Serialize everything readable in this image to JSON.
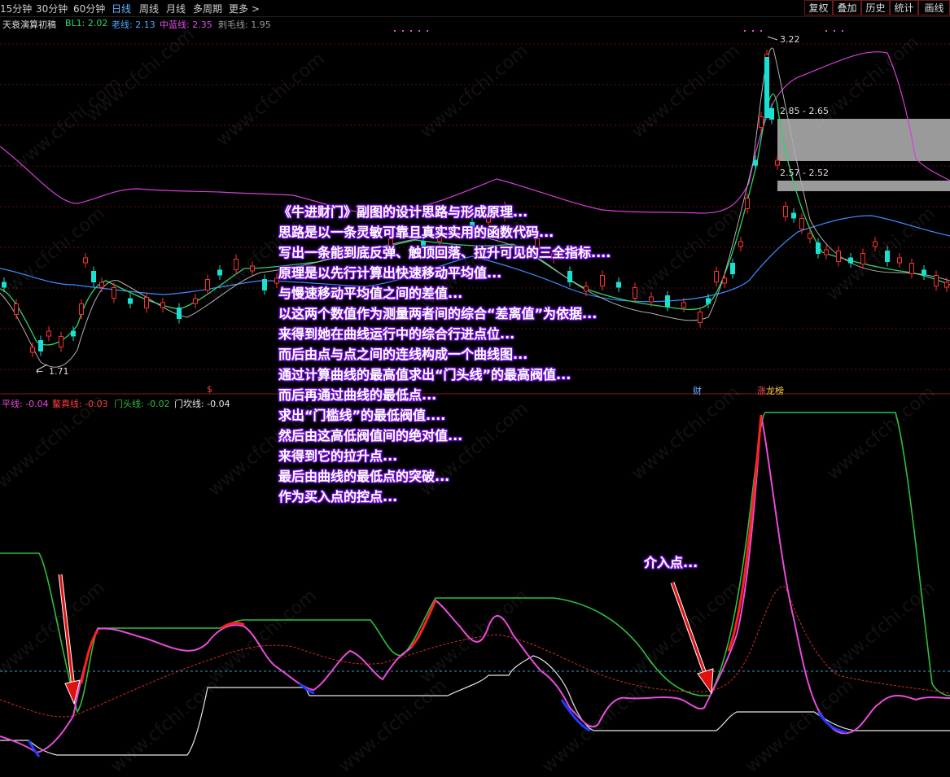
{
  "toolbar": {
    "periods": [
      "15分钟",
      "30分钟",
      "60分钟",
      "日线",
      "周线",
      "月线",
      "多周期",
      "更多 >"
    ],
    "active_period": "日线",
    "right_buttons": [
      "复权",
      "叠加",
      "历史",
      "统计",
      "画线"
    ]
  },
  "main_panel": {
    "title": "天衰演算初稿",
    "indicators": [
      {
        "label": "BL1: 2.02",
        "color": "#2fd46a"
      },
      {
        "label": "老线: 2.13",
        "color": "#4da6ff"
      },
      {
        "label": "中蓝线: 2.35",
        "color": "#e24be8"
      },
      {
        "label": "刺毛线: 1.95",
        "color": "#9a9a9a"
      }
    ],
    "price_labels": {
      "high": "3.22",
      "low": "1.71",
      "zone_upper": "2.85 - 2.65",
      "zone_lower": "2.57 - 2.52"
    },
    "event_markers": {
      "s": "$",
      "cai": "财",
      "zhang": "涨",
      "bang": "龙榜"
    }
  },
  "sub_panel": {
    "indicators": [
      {
        "label": "平线: -0.04",
        "color": "#e84bd8"
      },
      {
        "label": "鳌真线: -0.03",
        "color": "#ff3b3b"
      },
      {
        "label": "门头线: -0.02",
        "color": "#2fbf3a"
      },
      {
        "label": "门坎线: -0.04",
        "color": "#e6e6e6"
      }
    ]
  },
  "annotations": {
    "lines": [
      "《牛进财门》副图的设计思路与形成原理...",
      "思路是以一条灵敏可靠且真实实用的函数代码...",
      "写出一条能到底反弹、触顶回落、拉升可见的三全指标....",
      "原理是以先行计算出快速移动平均值...",
      "与慢速移动平均值之间的差值...",
      "以这两个数值作为测量两者间的综合“差离值”为依据...",
      "来得到她在曲线运行中的综合行进点位...",
      "而后由点与点之间的连线构成一个曲线图...",
      "通过计算曲线的最高值求出“门头线”的最高阀值...",
      "而后再通过曲线的最低点...",
      "求出“门槛线”的最低阀值....",
      "然后由这高低阀值间的绝对值...",
      "来得到它的拉升点...",
      "最后由曲线的最低点的突破...",
      "作为买入点的控点..."
    ],
    "entry_label": "介入点..."
  },
  "watermark": "www.cfchi.com"
}
